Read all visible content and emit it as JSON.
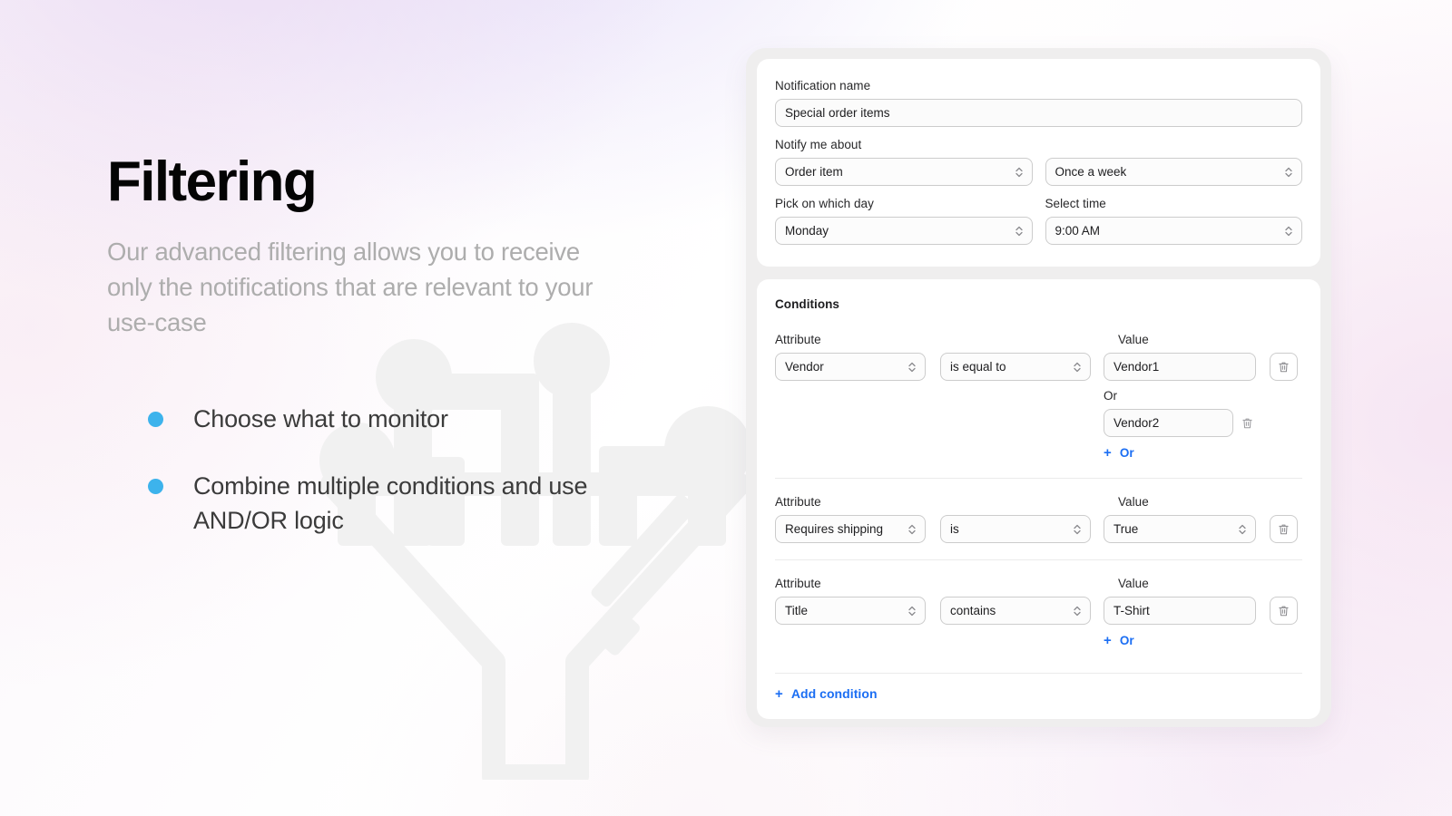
{
  "hero": {
    "title": "Filtering",
    "subtitle": "Our advanced filtering allows you to receive only the notifications that are relevant to your use-case",
    "bullets": [
      {
        "text": "Choose what to monitor"
      },
      {
        "text": "Combine multiple conditions and use AND/OR logic"
      }
    ],
    "bullet_color": "#3db3ec",
    "watermark_icons": [
      "circuit-board-icon",
      "funnel-icon"
    ],
    "watermark_color": "#f1f1f1"
  },
  "panel": {
    "schedule": {
      "name_label": "Notification name",
      "name_value": "Special order items",
      "name_placeholder": "Notification name",
      "about_label": "Notify me about",
      "about_value": "Order item",
      "frequency_value": "Once a week",
      "day_label": "Pick on which day",
      "day_value": "Monday",
      "time_label": "Select time",
      "time_value": "9:00 AM"
    },
    "conditions": {
      "heading": "Conditions",
      "attribute_label": "Attribute",
      "value_label": "Value",
      "or_label": "Or",
      "add_or_label": "Or",
      "add_condition_label": "Add condition",
      "plus_glyph": "+",
      "rows": [
        {
          "attribute": "Vendor",
          "operator": "is equal to",
          "value": "Vendor1",
          "value_is_select": false,
          "extra_values": [
            {
              "value": "Vendor2"
            }
          ],
          "show_add_or": true
        },
        {
          "attribute": "Requires shipping",
          "operator": "is",
          "value": "True",
          "value_is_select": true,
          "extra_values": [],
          "show_add_or": false
        },
        {
          "attribute": "Title",
          "operator": "contains",
          "value": "T-Shirt",
          "value_is_select": false,
          "extra_values": [],
          "show_add_or": true
        }
      ]
    },
    "colors": {
      "link": "#1b6ef3",
      "frame": "#efeeee",
      "card": "#ffffff",
      "border": "#cccccc"
    }
  }
}
